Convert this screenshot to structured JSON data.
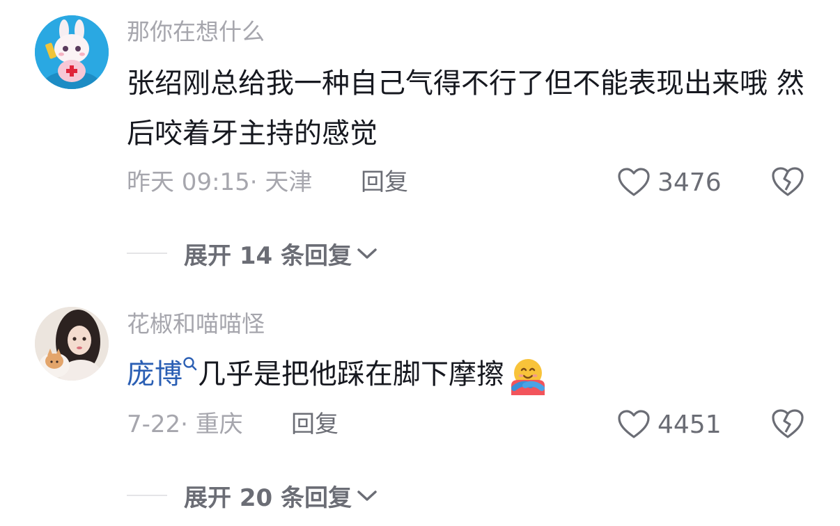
{
  "comments": [
    {
      "username": "那你在想什么",
      "text": "张绍刚总给我一种自己气得不行了但不能表现出来哦  然后咬着牙主持的感觉",
      "meta": "昨天 09:15· 天津",
      "reply_label": "回复",
      "likes": "3476",
      "expand_label": "展开 14 条回复"
    },
    {
      "username": "花椒和喵喵怪",
      "mention": "庞博",
      "text": "几乎是把他踩在脚下摩擦",
      "meta": "7-22· 重庆",
      "reply_label": "回复",
      "likes": "4451",
      "expand_label": "展开 20 条回复"
    }
  ],
  "icons": {
    "like": "heart-outline-icon",
    "dislike": "broken-heart-icon",
    "expand": "chevron-down-icon",
    "mention_search": "search-icon",
    "emoji": "hugging-face-emoji"
  },
  "colors": {
    "username": "#a6a6ad",
    "text": "#16181f",
    "mention": "#2b5fb4",
    "secondary": "#6b6d75"
  }
}
